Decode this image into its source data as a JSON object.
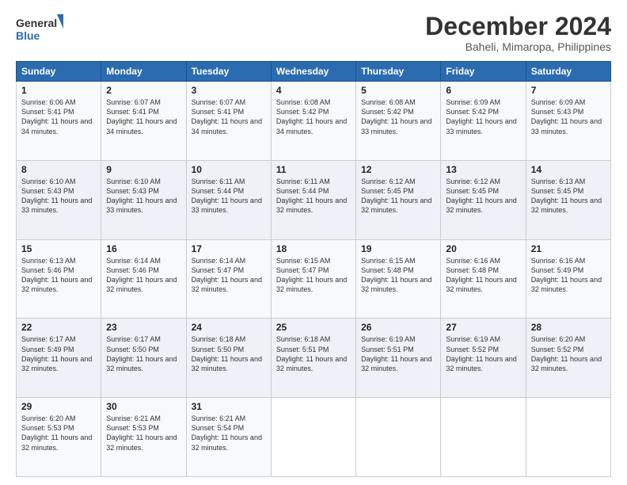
{
  "logo": {
    "line1": "General",
    "line2": "Blue"
  },
  "header": {
    "month": "December 2024",
    "location": "Baheli, Mimaropa, Philippines"
  },
  "weekdays": [
    "Sunday",
    "Monday",
    "Tuesday",
    "Wednesday",
    "Thursday",
    "Friday",
    "Saturday"
  ],
  "weeks": [
    [
      {
        "day": "1",
        "sunrise": "Sunrise: 6:06 AM",
        "sunset": "Sunset: 5:41 PM",
        "daylight": "Daylight: 11 hours and 34 minutes."
      },
      {
        "day": "2",
        "sunrise": "Sunrise: 6:07 AM",
        "sunset": "Sunset: 5:41 PM",
        "daylight": "Daylight: 11 hours and 34 minutes."
      },
      {
        "day": "3",
        "sunrise": "Sunrise: 6:07 AM",
        "sunset": "Sunset: 5:41 PM",
        "daylight": "Daylight: 11 hours and 34 minutes."
      },
      {
        "day": "4",
        "sunrise": "Sunrise: 6:08 AM",
        "sunset": "Sunset: 5:42 PM",
        "daylight": "Daylight: 11 hours and 34 minutes."
      },
      {
        "day": "5",
        "sunrise": "Sunrise: 6:08 AM",
        "sunset": "Sunset: 5:42 PM",
        "daylight": "Daylight: 11 hours and 33 minutes."
      },
      {
        "day": "6",
        "sunrise": "Sunrise: 6:09 AM",
        "sunset": "Sunset: 5:42 PM",
        "daylight": "Daylight: 11 hours and 33 minutes."
      },
      {
        "day": "7",
        "sunrise": "Sunrise: 6:09 AM",
        "sunset": "Sunset: 5:43 PM",
        "daylight": "Daylight: 11 hours and 33 minutes."
      }
    ],
    [
      {
        "day": "8",
        "sunrise": "Sunrise: 6:10 AM",
        "sunset": "Sunset: 5:43 PM",
        "daylight": "Daylight: 11 hours and 33 minutes."
      },
      {
        "day": "9",
        "sunrise": "Sunrise: 6:10 AM",
        "sunset": "Sunset: 5:43 PM",
        "daylight": "Daylight: 11 hours and 33 minutes."
      },
      {
        "day": "10",
        "sunrise": "Sunrise: 6:11 AM",
        "sunset": "Sunset: 5:44 PM",
        "daylight": "Daylight: 11 hours and 33 minutes."
      },
      {
        "day": "11",
        "sunrise": "Sunrise: 6:11 AM",
        "sunset": "Sunset: 5:44 PM",
        "daylight": "Daylight: 11 hours and 32 minutes."
      },
      {
        "day": "12",
        "sunrise": "Sunrise: 6:12 AM",
        "sunset": "Sunset: 5:45 PM",
        "daylight": "Daylight: 11 hours and 32 minutes."
      },
      {
        "day": "13",
        "sunrise": "Sunrise: 6:12 AM",
        "sunset": "Sunset: 5:45 PM",
        "daylight": "Daylight: 11 hours and 32 minutes."
      },
      {
        "day": "14",
        "sunrise": "Sunrise: 6:13 AM",
        "sunset": "Sunset: 5:45 PM",
        "daylight": "Daylight: 11 hours and 32 minutes."
      }
    ],
    [
      {
        "day": "15",
        "sunrise": "Sunrise: 6:13 AM",
        "sunset": "Sunset: 5:46 PM",
        "daylight": "Daylight: 11 hours and 32 minutes."
      },
      {
        "day": "16",
        "sunrise": "Sunrise: 6:14 AM",
        "sunset": "Sunset: 5:46 PM",
        "daylight": "Daylight: 11 hours and 32 minutes."
      },
      {
        "day": "17",
        "sunrise": "Sunrise: 6:14 AM",
        "sunset": "Sunset: 5:47 PM",
        "daylight": "Daylight: 11 hours and 32 minutes."
      },
      {
        "day": "18",
        "sunrise": "Sunrise: 6:15 AM",
        "sunset": "Sunset: 5:47 PM",
        "daylight": "Daylight: 11 hours and 32 minutes."
      },
      {
        "day": "19",
        "sunrise": "Sunrise: 6:15 AM",
        "sunset": "Sunset: 5:48 PM",
        "daylight": "Daylight: 11 hours and 32 minutes."
      },
      {
        "day": "20",
        "sunrise": "Sunrise: 6:16 AM",
        "sunset": "Sunset: 5:48 PM",
        "daylight": "Daylight: 11 hours and 32 minutes."
      },
      {
        "day": "21",
        "sunrise": "Sunrise: 6:16 AM",
        "sunset": "Sunset: 5:49 PM",
        "daylight": "Daylight: 11 hours and 32 minutes."
      }
    ],
    [
      {
        "day": "22",
        "sunrise": "Sunrise: 6:17 AM",
        "sunset": "Sunset: 5:49 PM",
        "daylight": "Daylight: 11 hours and 32 minutes."
      },
      {
        "day": "23",
        "sunrise": "Sunrise: 6:17 AM",
        "sunset": "Sunset: 5:50 PM",
        "daylight": "Daylight: 11 hours and 32 minutes."
      },
      {
        "day": "24",
        "sunrise": "Sunrise: 6:18 AM",
        "sunset": "Sunset: 5:50 PM",
        "daylight": "Daylight: 11 hours and 32 minutes."
      },
      {
        "day": "25",
        "sunrise": "Sunrise: 6:18 AM",
        "sunset": "Sunset: 5:51 PM",
        "daylight": "Daylight: 11 hours and 32 minutes."
      },
      {
        "day": "26",
        "sunrise": "Sunrise: 6:19 AM",
        "sunset": "Sunset: 5:51 PM",
        "daylight": "Daylight: 11 hours and 32 minutes."
      },
      {
        "day": "27",
        "sunrise": "Sunrise: 6:19 AM",
        "sunset": "Sunset: 5:52 PM",
        "daylight": "Daylight: 11 hours and 32 minutes."
      },
      {
        "day": "28",
        "sunrise": "Sunrise: 6:20 AM",
        "sunset": "Sunset: 5:52 PM",
        "daylight": "Daylight: 11 hours and 32 minutes."
      }
    ],
    [
      {
        "day": "29",
        "sunrise": "Sunrise: 6:20 AM",
        "sunset": "Sunset: 5:53 PM",
        "daylight": "Daylight: 11 hours and 32 minutes."
      },
      {
        "day": "30",
        "sunrise": "Sunrise: 6:21 AM",
        "sunset": "Sunset: 5:53 PM",
        "daylight": "Daylight: 11 hours and 32 minutes."
      },
      {
        "day": "31",
        "sunrise": "Sunrise: 6:21 AM",
        "sunset": "Sunset: 5:54 PM",
        "daylight": "Daylight: 11 hours and 32 minutes."
      },
      null,
      null,
      null,
      null
    ]
  ]
}
